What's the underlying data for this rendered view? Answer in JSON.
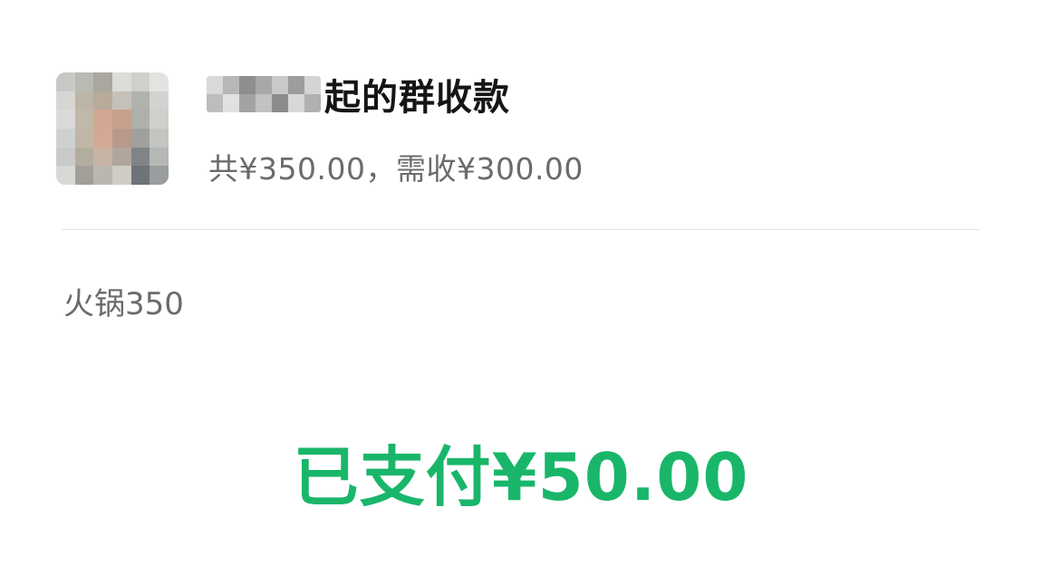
{
  "colors": {
    "accent_paid": "#19b66a",
    "title": "#151515",
    "secondary_text": "#6b6b6b",
    "divider": "#e4e4e4"
  },
  "header": {
    "avatar_icon": "blurred-avatar",
    "title_suffix": "起的群收款",
    "summary": "共¥350.00，需收¥300.00"
  },
  "detail": {
    "note": "火锅350"
  },
  "status": {
    "paid_text": "已支付¥50.00"
  }
}
